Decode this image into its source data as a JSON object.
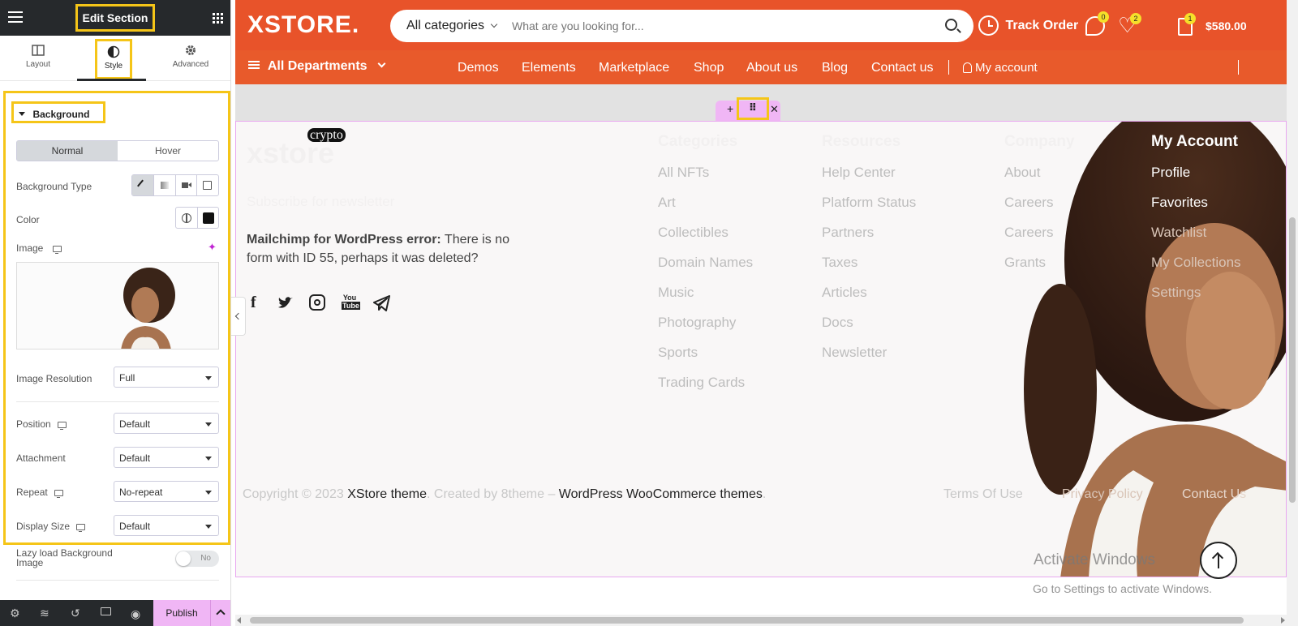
{
  "panel": {
    "title": "Edit Section",
    "tabs": [
      {
        "label": "Layout"
      },
      {
        "label": "Style"
      },
      {
        "label": "Advanced"
      }
    ],
    "section_title": "Background",
    "state_toggle": {
      "normal": "Normal",
      "hover": "Hover"
    },
    "fields": {
      "background_type": "Background Type",
      "color": "Color",
      "image": "Image",
      "image_resolution": {
        "label": "Image Resolution",
        "value": "Full"
      },
      "position": {
        "label": "Position",
        "value": "Default"
      },
      "attachment": {
        "label": "Attachment",
        "value": "Default"
      },
      "repeat": {
        "label": "Repeat",
        "value": "No-repeat"
      },
      "display_size": {
        "label": "Display Size",
        "value": "Default"
      },
      "lazy_load": {
        "label": "Lazy load Background Image",
        "value": "No"
      }
    },
    "publish_label": "Publish"
  },
  "site": {
    "logo": "XSTORE.",
    "search": {
      "category": "All categories",
      "placeholder": "What are you looking for..."
    },
    "track_order": "Track Order",
    "badges": {
      "compare": "0",
      "wishlist": "2",
      "cart": "1"
    },
    "cart_total": "$580.00",
    "departments": "All Departments",
    "nav": [
      "Demos",
      "Elements",
      "Marketplace",
      "Shop",
      "About us",
      "Blog",
      "Contact us"
    ],
    "my_account": "My account",
    "footer": {
      "brand": "xstore",
      "crypto_tag": "crypto",
      "subscribe": "Subscribe for newsletter",
      "error_bold": "Mailchimp for WordPress error:",
      "error_text": "There is no form with ID 55, perhaps it was deleted?",
      "columns": [
        {
          "title": "Categories",
          "links": [
            "All NFTs",
            "Art",
            "Collectibles",
            "Domain Names",
            "Music",
            "Photography",
            "Sports",
            "Trading Cards"
          ]
        },
        {
          "title": "Resources",
          "links": [
            "Help Center",
            "Platform Status",
            "Partners",
            "Taxes",
            "Articles",
            "Docs",
            "Newsletter"
          ]
        },
        {
          "title": "Company",
          "links": [
            "About",
            "Careers",
            "Careers",
            "Grants"
          ]
        },
        {
          "title": "My Account",
          "links": [
            "Profile",
            "Favorites",
            "Watchlist",
            "My Collections",
            "Settings"
          ]
        }
      ],
      "copyright_pre": "Copyright © 2023",
      "copyright_theme": "XStore theme",
      "copyright_mid": ". Created by 8theme –",
      "copyright_link": "WordPress WooCommerce themes",
      "copyright_end": ".",
      "bottom_links": [
        "Terms Of Use",
        "Privacy Policy",
        "Contact Us"
      ]
    },
    "watermark": {
      "title": "Activate Windows",
      "subtitle": "Go to Settings to activate Windows."
    }
  },
  "colors": {
    "accent": "#e8532a",
    "editor_dark": "#26292c",
    "highlight": "#f5c518",
    "pink": "#f0b6f5"
  }
}
